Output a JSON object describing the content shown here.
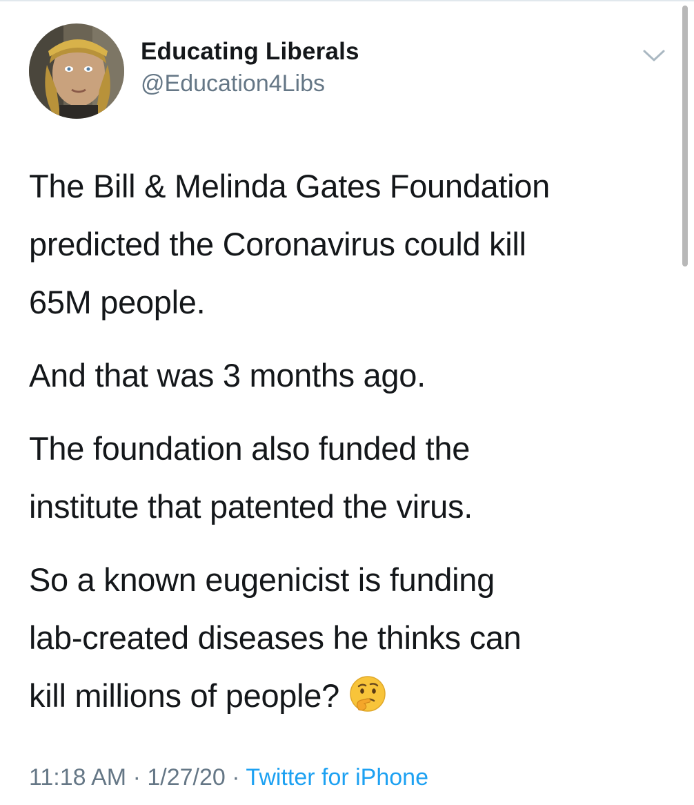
{
  "tweet": {
    "author": {
      "display_name": "Educating Liberals",
      "handle": "@Education4Libs"
    },
    "menu_icon": "chevron-down-icon",
    "paragraphs": [
      [
        "The Bill & Melinda Gates Foundation",
        "predicted the Coronavirus could kill",
        "65M people."
      ],
      [
        "And that was 3 months ago."
      ],
      [
        "The foundation also funded the",
        "institute that patented the virus."
      ],
      [
        "So a known eugenicist is funding",
        "lab-created diseases he thinks can",
        "kill millions of people?"
      ]
    ],
    "trailing_emoji": "thinking-face-emoji",
    "timestamp": {
      "time": "11:18 AM",
      "separator1": " · ",
      "date": "1/27/20",
      "separator2": " · ",
      "source": "Twitter for iPhone"
    }
  },
  "colors": {
    "text": "#14171a",
    "secondary": "#657786",
    "link": "#1da1f2",
    "divider": "#e1e8ed"
  }
}
